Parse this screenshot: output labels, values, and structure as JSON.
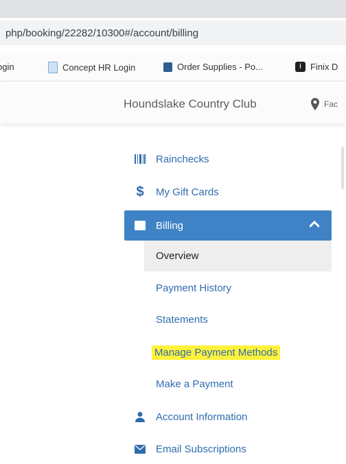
{
  "browser": {
    "tab_fragment": "",
    "url": "php/booking/22282/10300#/account/billing",
    "bookmarks": [
      {
        "label": "ogin",
        "icon": "none"
      },
      {
        "label": "Concept HR Login",
        "icon": "document-icon"
      },
      {
        "label": "Order Supplies - Po...",
        "icon": "supplies-icon"
      },
      {
        "label": "Finix D",
        "icon": "finix-icon"
      }
    ]
  },
  "site": {
    "club_name": "Houndslake Country Club",
    "facility_label": "Fac"
  },
  "menu": {
    "items": [
      {
        "label": "Rainchecks",
        "icon": "barcode-icon"
      },
      {
        "label": "My Gift Cards",
        "icon": "dollar-icon"
      },
      {
        "label": "Billing",
        "icon": "credit-card-icon",
        "expanded": true
      },
      {
        "label": "Account Information",
        "icon": "user-icon"
      },
      {
        "label": "Email Subscriptions",
        "icon": "envelope-icon"
      }
    ],
    "billing_submenu": [
      {
        "label": "Overview",
        "active": true
      },
      {
        "label": "Payment History"
      },
      {
        "label": "Statements"
      },
      {
        "label": "Manage Payment Methods",
        "highlighted": true
      },
      {
        "label": "Make a Payment"
      }
    ]
  },
  "colors": {
    "accent": "#3f82c6",
    "link": "#2f6cae",
    "highlight": "#fff23b"
  }
}
